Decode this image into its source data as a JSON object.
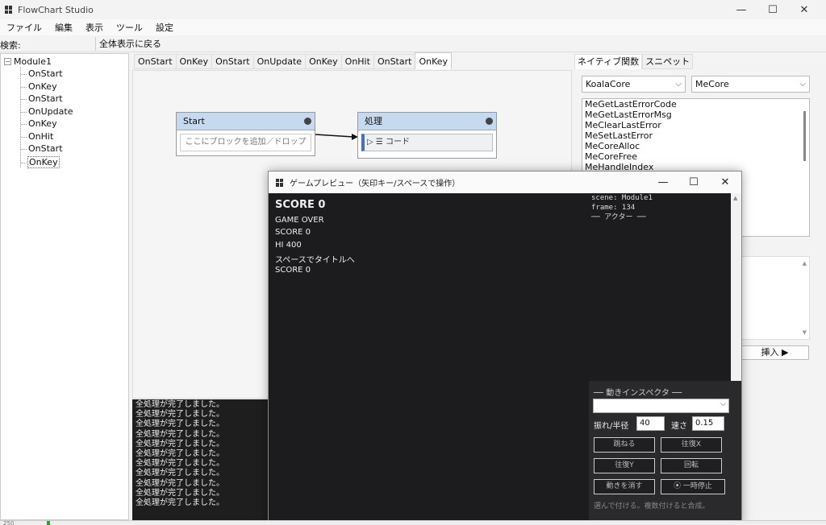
{
  "app": {
    "title": "FlowChart Studio"
  },
  "window_controls": {
    "minimize": "—",
    "maximize": "☐",
    "close": "✕"
  },
  "menu": [
    "ファイル",
    "編集",
    "表示",
    "ツール",
    "設定"
  ],
  "toolbar": {
    "search_label": "検索:",
    "search_value": "",
    "fit_all_label": "全体表示に戻る"
  },
  "tree": {
    "root": "Module1",
    "expander": "−",
    "items": [
      "OnStart",
      "OnKey",
      "OnStart",
      "OnUpdate",
      "OnKey",
      "OnHit",
      "OnStart",
      "OnKey"
    ]
  },
  "tabs": [
    "OnStart",
    "OnKey",
    "OnStart",
    "OnUpdate",
    "OnKey",
    "OnHit",
    "OnStart",
    "OnKey"
  ],
  "nodes": {
    "start": {
      "title": "Start",
      "drop_hint": "ここにブロックを追加／ドロップ"
    },
    "process": {
      "title": "処理",
      "block_label": "▷ ☰  コード"
    }
  },
  "output_lines": [
    "全処理が完了しました。",
    "全処理が完了しました。",
    "全処理が完了しました。",
    "全処理が完了しました。",
    "全処理が完了しました。",
    "全処理が完了しました。",
    "全処理が完了しました。",
    "全処理が完了しました。",
    "全処理が完了しました。",
    "全処理が完了しました。",
    "全処理が完了しました。"
  ],
  "right": {
    "tabs": [
      "ネイティブ関数",
      "スニペット"
    ],
    "combo_left": "KoalaCore",
    "combo_right": "MeCore",
    "functions": [
      "MeGetLastErrorCode",
      "MeGetLastErrorMsg",
      "MeClearLastError",
      "MeSetLastError",
      "MeCoreAlloc",
      "MeCoreFree",
      "MeHandleIndex"
    ],
    "insert_label": "挿入 ▶"
  },
  "preview": {
    "title": "ゲームプレビュー（矢印キー/スペースで操作）",
    "score_title": "SCORE 0",
    "lines": [
      "GAME OVER",
      "SCORE 0",
      "HI 400",
      "スペースでタイトルへ",
      "SCORE 0"
    ],
    "debug": [
      "scene: Module1",
      "frame: 134",
      "── アクター ──"
    ],
    "scroll_up": "▲"
  },
  "inspector": {
    "legend": "── 動きインスペクタ ──",
    "combo_value": "",
    "amp_label": "振れ/半径",
    "amp_value": "40",
    "speed_label": "速さ",
    "speed_value": "0.15",
    "buttons": [
      "跳ねる",
      "往復X",
      "往復Y",
      "回転",
      "動きを消す",
      "⦿ 一時停止"
    ],
    "hint": "選んで付ける。複数付けると合成。"
  },
  "snippet_scroll": {
    "up": "▲",
    "down": "▼"
  },
  "status": {
    "left_number": "250"
  }
}
